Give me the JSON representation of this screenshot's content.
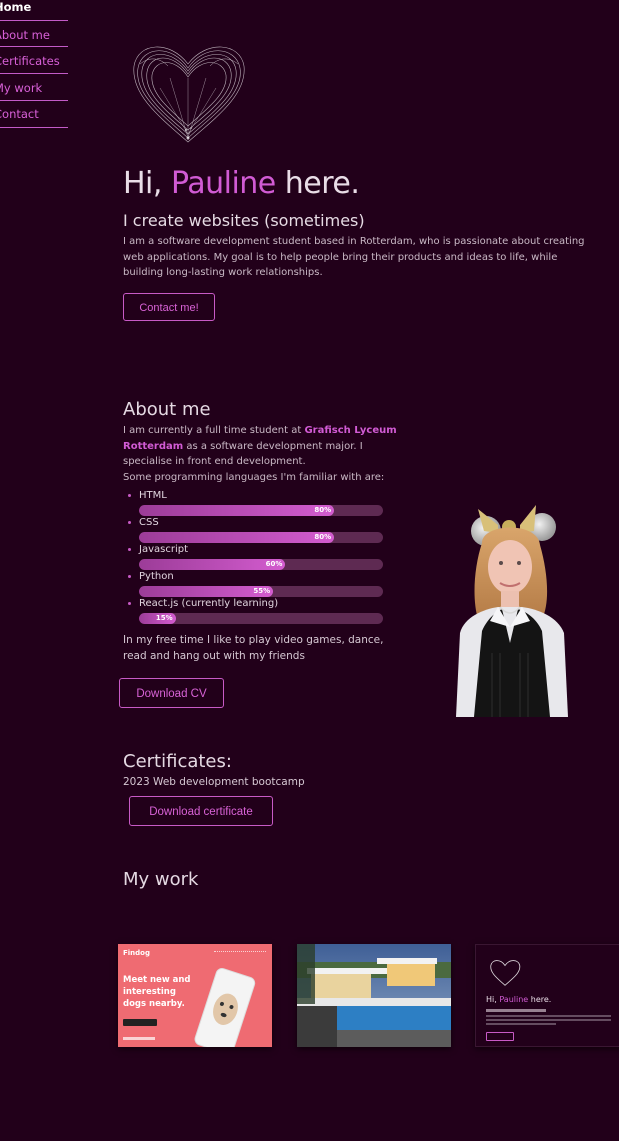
{
  "nav": {
    "items": [
      {
        "label": "Home",
        "active": true
      },
      {
        "label": "About me"
      },
      {
        "label": "Certificates"
      },
      {
        "label": "My work"
      },
      {
        "label": "Contact"
      }
    ]
  },
  "hero": {
    "greeting_prefix": "Hi, ",
    "name": "Pauline",
    "greeting_suffix": " here.",
    "subtitle": "I create websites (sometimes)",
    "intro": "I am a software development student based in Rotterdam, who is passionate about creating web applications. My goal is to help people bring their products and ideas to life, while building long-lasting work relationships.",
    "contact_button": "Contact me!"
  },
  "about": {
    "title": "About me",
    "p1_prefix": "I am currently a full time student at ",
    "school": "Grafisch Lyceum Rotterdam",
    "p1_suffix": " as a software development major. I specialise in front end development.",
    "p2": "Some programming languages I'm familiar with are:",
    "skills": [
      {
        "name": "HTML",
        "percent": 80,
        "label": "80%"
      },
      {
        "name": "CSS",
        "percent": 80,
        "label": "80%"
      },
      {
        "name": "Javascript",
        "percent": 60,
        "label": "60%"
      },
      {
        "name": "Python",
        "percent": 55,
        "label": "55%"
      },
      {
        "name": "React.js (currently learning)",
        "percent": 15,
        "label": "15%"
      }
    ],
    "free_time": "In my free time I like to play video games, dance, read and hang out with my friends",
    "cv_button": "Download CV"
  },
  "certificates": {
    "title": "Certificates:",
    "item": "2023 Web development bootcamp",
    "button": "Download certificate"
  },
  "work": {
    "title": "My work",
    "cards": [
      {
        "brand": "Findog",
        "headline_1": "Meet new and",
        "headline_2": "interesting",
        "headline_3": "dogs nearby."
      },
      {},
      {
        "greeting_prefix": "Hi, ",
        "name": "Pauline",
        "greeting_suffix": " here."
      }
    ]
  },
  "colors": {
    "background": "#22001a",
    "accent": "#d15bd4",
    "nav_border": "#c35bc8"
  }
}
